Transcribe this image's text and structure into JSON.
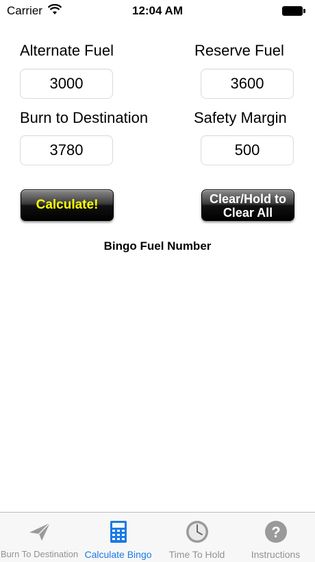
{
  "status_bar": {
    "carrier": "Carrier",
    "time": "12:04 AM"
  },
  "form": {
    "alternate_fuel": {
      "label": "Alternate Fuel",
      "value": "3000"
    },
    "reserve_fuel": {
      "label": "Reserve Fuel",
      "value": "3600"
    },
    "burn_to_destination": {
      "label": "Burn to Destination",
      "value": "3780"
    },
    "safety_margin": {
      "label": "Safety Margin",
      "value": "500"
    }
  },
  "buttons": {
    "calculate": "Calculate!",
    "clear_line1": "Clear/Hold to",
    "clear_line2": "Clear All"
  },
  "result": {
    "title": "Bingo Fuel Number"
  },
  "tabs": [
    {
      "label": "Burn To Destination",
      "icon": "paper-plane-icon",
      "active": false
    },
    {
      "label": "Calculate Bingo",
      "icon": "calculator-icon",
      "active": true
    },
    {
      "label": "Time To Hold",
      "icon": "clock-icon",
      "active": false
    },
    {
      "label": "Instructions",
      "icon": "question-icon",
      "active": false
    }
  ],
  "colors": {
    "accent": "#1a7ae6",
    "calculate_text": "#ffff00",
    "inactive_tab": "#929292"
  }
}
